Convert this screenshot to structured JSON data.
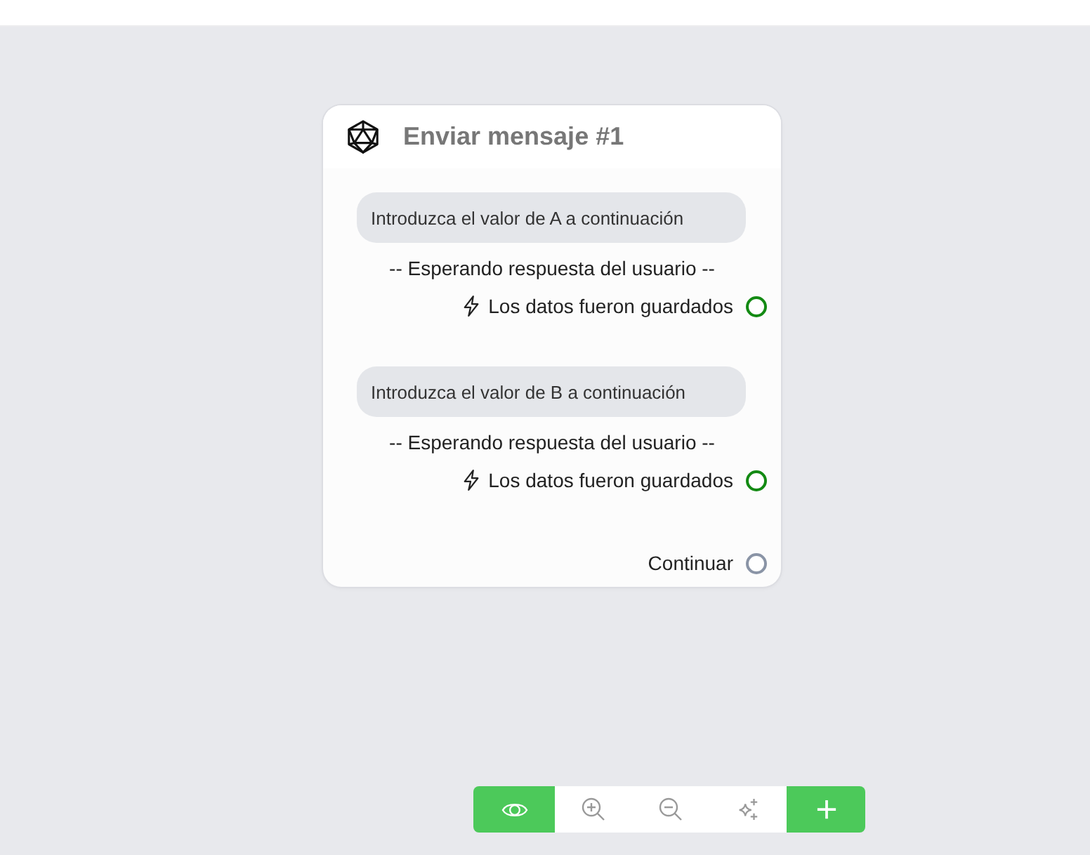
{
  "node": {
    "title": "Enviar mensaje #1",
    "items": [
      {
        "kind": "prompt",
        "text": "Introduzca el valor de A a continuación"
      },
      {
        "kind": "status",
        "text": "-- Esperando respuesta del usuario --"
      },
      {
        "kind": "event",
        "text": "Los datos fueron guardados"
      },
      {
        "kind": "prompt",
        "text": "Introduzca el valor de B a continuación"
      },
      {
        "kind": "status",
        "text": "-- Esperando respuesta del usuario --"
      },
      {
        "kind": "event",
        "text": "Los datos fueron guardados"
      },
      {
        "kind": "next",
        "text": "Continuar"
      }
    ]
  },
  "toolbar": {
    "view_toggle": {
      "on": true
    },
    "buttons": [
      {
        "kind": "zoom-in"
      },
      {
        "kind": "zoom-out"
      },
      {
        "kind": "auto-layout"
      },
      {
        "kind": "add"
      }
    ]
  }
}
